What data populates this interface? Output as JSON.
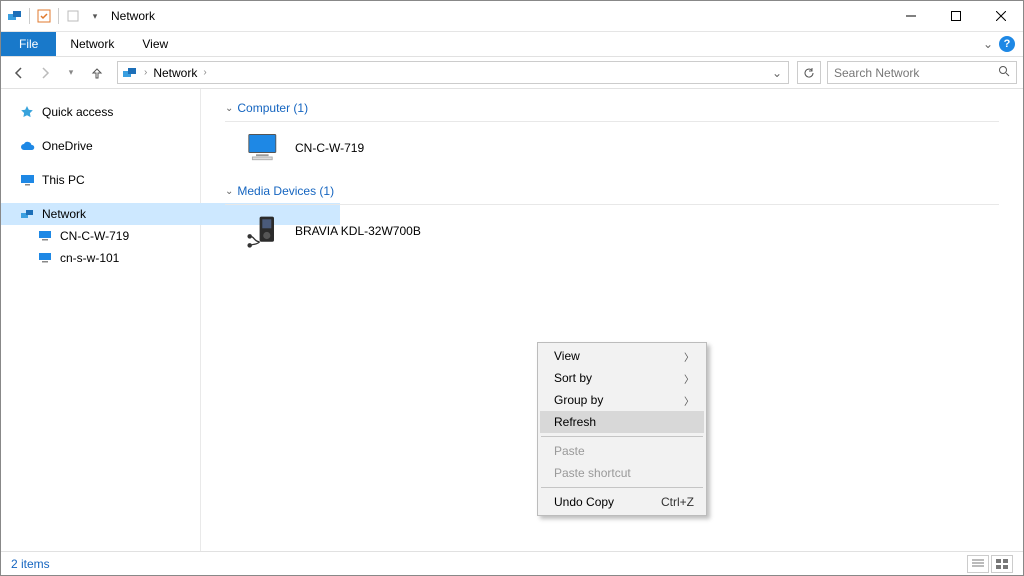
{
  "title": "Network",
  "ribbon": {
    "file": "File",
    "tabs": [
      "Network",
      "View"
    ]
  },
  "address": {
    "location": "Network",
    "search_placeholder": "Search Network"
  },
  "nav": {
    "quick_access": "Quick access",
    "onedrive": "OneDrive",
    "this_pc": "This PC",
    "network": "Network",
    "net_children": [
      "CN-C-W-719",
      "cn-s-w-101"
    ]
  },
  "groups": [
    {
      "label": "Computer (1)",
      "items": [
        "CN-C-W-719"
      ],
      "kind": "computer"
    },
    {
      "label": "Media Devices (1)",
      "items": [
        "BRAVIA KDL-32W700B"
      ],
      "kind": "media"
    }
  ],
  "context_menu": {
    "view": "View",
    "sort_by": "Sort by",
    "group_by": "Group by",
    "refresh": "Refresh",
    "paste": "Paste",
    "paste_shortcut": "Paste shortcut",
    "undo_copy": "Undo Copy",
    "undo_shortcut": "Ctrl+Z"
  },
  "status": {
    "items": "2 items"
  }
}
